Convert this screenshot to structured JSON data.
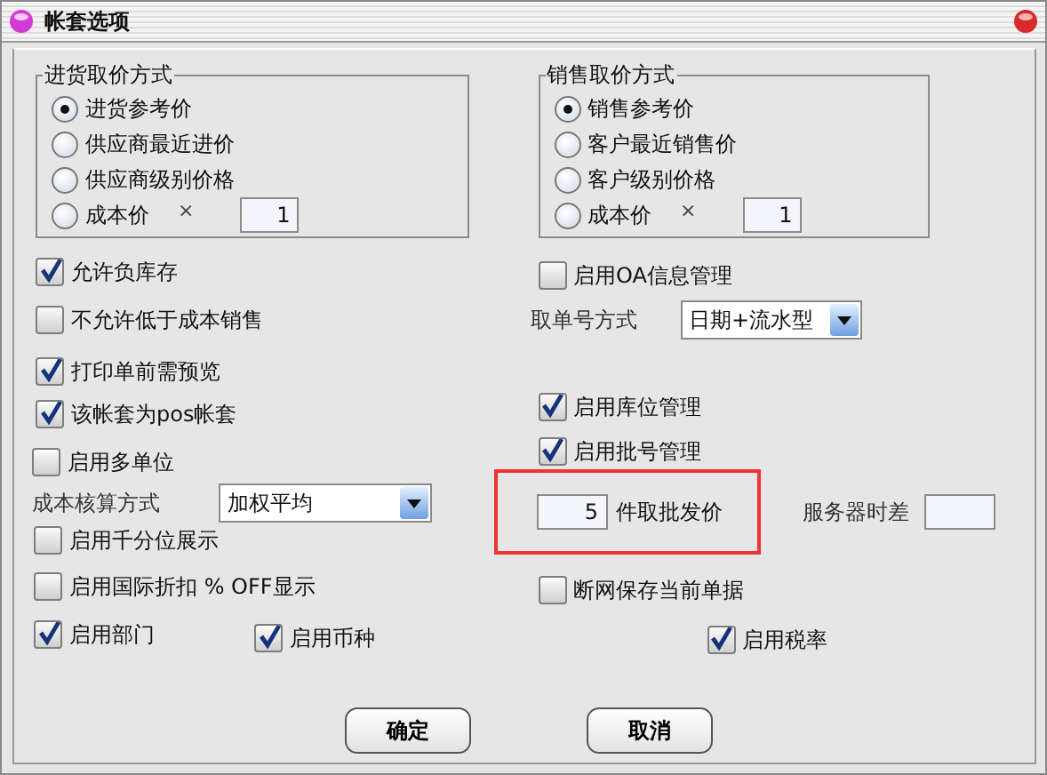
{
  "window": {
    "title": "帐套选项"
  },
  "groups": [
    {
      "title": "进货取价方式",
      "options": [
        {
          "label": "进货参考价",
          "selected": true
        },
        {
          "label": "供应商最近进价",
          "selected": false
        },
        {
          "label": "供应商级别价格",
          "selected": false
        },
        {
          "label": "成本价",
          "selected": false,
          "sign": "×",
          "value": "1"
        }
      ]
    },
    {
      "title": "销售取价方式",
      "options": [
        {
          "label": "销售参考价",
          "selected": true
        },
        {
          "label": "客户最近销售价",
          "selected": false
        },
        {
          "label": "客户级别价格",
          "selected": false
        },
        {
          "label": "成本价",
          "selected": false,
          "sign": "×",
          "value": "1"
        }
      ]
    }
  ],
  "left_options": [
    {
      "kind": "checkbox",
      "label": "允许负库存",
      "checked": true
    },
    {
      "kind": "checkbox",
      "label": "不允许低于成本销售",
      "checked": false
    },
    {
      "kind": "checkbox",
      "label": "打印单前需预览",
      "checked": true
    },
    {
      "kind": "checkbox",
      "label": "该帐套为pos帐套",
      "checked": true
    },
    {
      "kind": "checkbox",
      "label": "启用多单位",
      "checked": false
    },
    {
      "kind": "select",
      "label": "成本核算方式",
      "value": "加权平均"
    },
    {
      "kind": "checkbox",
      "label": "启用千分位展示",
      "checked": false
    },
    {
      "kind": "checkbox",
      "label": "启用国际折扣 % OFF显示",
      "checked": false
    },
    {
      "kind": "checkbox",
      "label": "启用部门",
      "checked": true
    },
    {
      "kind": "checkbox",
      "label": "启用币种",
      "checked": true
    }
  ],
  "right_options": [
    {
      "kind": "checkbox",
      "label": "启用OA信息管理",
      "checked": false
    },
    {
      "kind": "select",
      "label": "取单号方式",
      "value": "日期+流水型"
    },
    {
      "kind": "checkbox",
      "label": "启用库位管理",
      "checked": true
    },
    {
      "kind": "checkbox",
      "label": "启用批号管理",
      "checked": true
    },
    {
      "kind": "wholesale",
      "value": "5",
      "label": "件取批发价",
      "highlighted": true,
      "side_label": "服务器时差"
    },
    {
      "kind": "checkbox",
      "label": "断网保存当前单据",
      "checked": false
    },
    {
      "kind": "checkbox",
      "label": "启用税率",
      "checked": true
    }
  ],
  "buttons": [
    "确定",
    "取消"
  ]
}
